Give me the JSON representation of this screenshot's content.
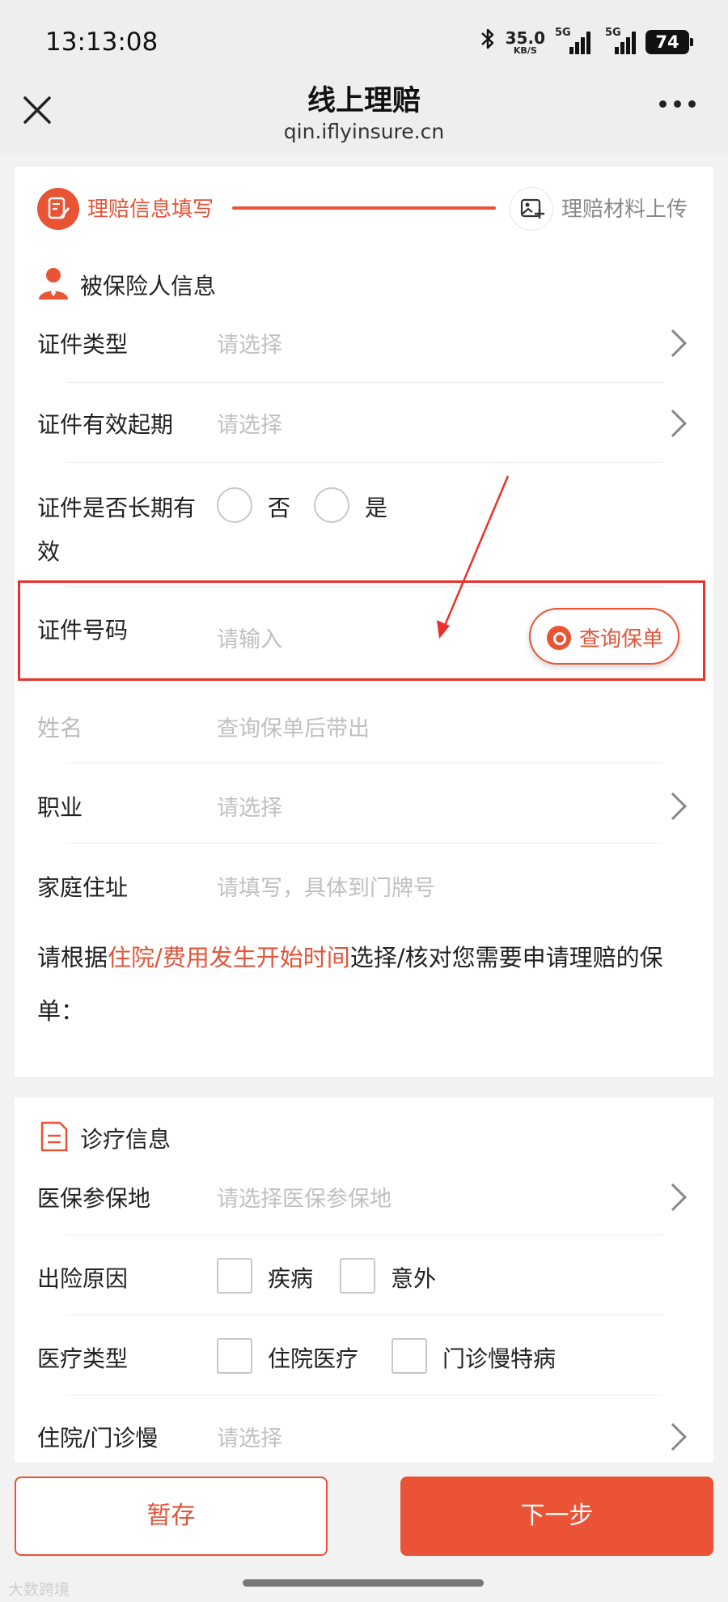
{
  "status_bar": {
    "time": "13:13:08",
    "net_speed": "35.0",
    "net_unit": "KB/S",
    "sim1": "5G",
    "sim2": "5G",
    "battery": "74"
  },
  "nav": {
    "title": "线上理赔",
    "subtitle": "qin.iflyinsure.cn"
  },
  "steps": [
    {
      "label": "理赔信息填写",
      "active": true
    },
    {
      "label": "理赔材料上传",
      "active": false
    }
  ],
  "insured_section": {
    "title": "被保险人信息",
    "id_type": {
      "label": "证件类型",
      "value": "请选择"
    },
    "id_start": {
      "label": "证件有效起期",
      "value": "请选择"
    },
    "id_longterm": {
      "label": "证件是否长期有效",
      "options": [
        "否",
        "是"
      ]
    },
    "id_number": {
      "label": "证件号码",
      "placeholder": "请输入",
      "button": "查询保单"
    },
    "name": {
      "label": "姓名",
      "value": "查询保单后带出"
    },
    "occupation": {
      "label": "职业",
      "value": "请选择"
    },
    "address": {
      "label": "家庭住址",
      "placeholder": "请填写，具体到门牌号"
    },
    "notice": {
      "before": "请根据",
      "highlight": "住院/费用发生开始时间",
      "after": "选择/核对您需要申请理赔的保单："
    }
  },
  "medical_section": {
    "title": "诊疗信息",
    "insurance_place": {
      "label": "医保参保地",
      "value": "请选择医保参保地"
    },
    "cause": {
      "label": "出险原因",
      "options": [
        "疾病",
        "意外"
      ]
    },
    "medical_type": {
      "label": "医疗类型",
      "options": [
        "住院医疗",
        "门诊慢特病"
      ]
    },
    "hospital_type": {
      "label": "住院/门诊慢",
      "value": "请选择"
    }
  },
  "buttons": {
    "save": "暂存",
    "next": "下一步"
  },
  "watermark": "大数跨境",
  "colors": {
    "accent": "#e95435",
    "highlight_border": "#e8312b",
    "placeholder": "#c0c0c0"
  }
}
